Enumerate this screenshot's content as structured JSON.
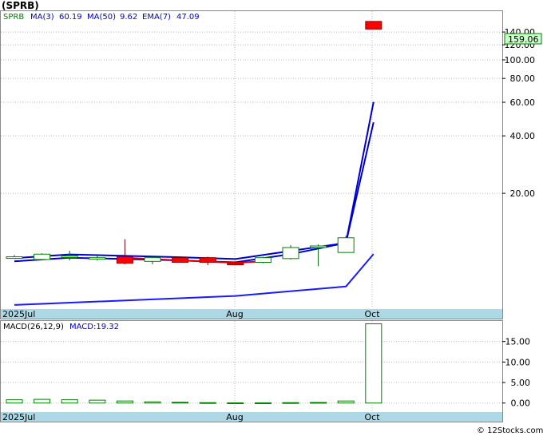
{
  "title": "(SPRB)",
  "footer": "© 12Stocks.com",
  "legend": {
    "symbol": "SPRB",
    "ma3_label": "MA(3)",
    "ma3_value": "60.19",
    "ma50_label": "MA(50)",
    "ma50_value": "9.62",
    "ema7_label": "EMA(7)",
    "ema7_value": "47.09"
  },
  "macd_legend": {
    "params": "MACD(26,12,9)",
    "label": "MACD:19.32"
  },
  "last_price_tag": "159.06",
  "colors": {
    "up": "#008000",
    "down": "#ff0000",
    "ma3": "#0000cc",
    "ma50": "#1a1aff",
    "ema7": "#dd0000",
    "axis_band": "#add8e6",
    "price_tag_bg": "#ccffcc"
  },
  "chart_data": [
    {
      "type": "candlestick",
      "yscale": "log",
      "ylim": [
        5,
        180
      ],
      "y_ticks": [
        "20.00",
        "40.00",
        "60.00",
        "80.00",
        "100.00",
        "120.00",
        "140.00"
      ],
      "x_labels": [
        "2025Jul",
        "Aug",
        "Oct"
      ],
      "last_price": 159.06,
      "candles": [
        {
          "i": 0,
          "open": 9.3,
          "close": 9.3,
          "high": 9.5,
          "low": 9.1
        },
        {
          "i": 1,
          "open": 9.0,
          "close": 9.6,
          "high": 9.7,
          "low": 9.0
        },
        {
          "i": 2,
          "open": 9.4,
          "close": 9.4,
          "high": 10.0,
          "low": 8.9
        },
        {
          "i": 3,
          "open": 9.2,
          "close": 9.2,
          "high": 9.5,
          "low": 8.9
        },
        {
          "i": 4,
          "open": 9.3,
          "close": 8.6,
          "high": 11.5,
          "low": 8.5
        },
        {
          "i": 5,
          "open": 8.8,
          "close": 9.2,
          "high": 9.3,
          "low": 8.5
        },
        {
          "i": 6,
          "open": 9.2,
          "close": 8.7,
          "high": 9.3,
          "low": 8.7
        },
        {
          "i": 7,
          "open": 9.2,
          "close": 8.7,
          "high": 9.3,
          "low": 8.4
        },
        {
          "i": 8,
          "open": 8.6,
          "close": 8.5,
          "high": 8.8,
          "low": 8.5
        },
        {
          "i": 9,
          "open": 8.7,
          "close": 9.2,
          "high": 9.3,
          "low": 8.6
        },
        {
          "i": 10,
          "open": 9.1,
          "close": 10.4,
          "high": 10.7,
          "low": 9.0
        },
        {
          "i": 11,
          "open": 10.6,
          "close": 10.6,
          "high": 10.8,
          "low": 8.3
        },
        {
          "i": 12,
          "open": 9.8,
          "close": 11.7,
          "high": 12.0,
          "low": 9.8
        },
        {
          "i": 13,
          "open": 159.06,
          "close": 145.0,
          "high": 159.06,
          "low": 145.0
        }
      ],
      "ma3": [
        [
          0,
          8.8
        ],
        [
          2,
          9.2
        ],
        [
          6,
          8.9
        ],
        [
          8,
          8.7
        ],
        [
          10,
          9.6
        ],
        [
          12,
          11.0
        ],
        [
          13,
          60.19
        ]
      ],
      "ma50": [
        [
          0,
          5.2
        ],
        [
          8,
          5.8
        ],
        [
          12,
          6.5
        ],
        [
          13,
          9.62
        ]
      ],
      "ema7": [
        [
          4,
          9.2
        ],
        [
          6,
          8.9
        ],
        [
          8,
          8.65
        ],
        [
          9,
          8.8
        ]
      ]
    },
    {
      "type": "bar",
      "name": "MACD",
      "ylim": [
        -2,
        20
      ],
      "y_ticks": [
        "0.00",
        "5.00",
        "10.00",
        "15.00"
      ],
      "x_labels": [
        "2025Jul",
        "Aug",
        "Oct"
      ],
      "bars": [
        {
          "i": 0,
          "value": 0.8
        },
        {
          "i": 1,
          "value": 0.9
        },
        {
          "i": 2,
          "value": 0.8
        },
        {
          "i": 3,
          "value": 0.7
        },
        {
          "i": 4,
          "value": 0.5
        },
        {
          "i": 5,
          "value": 0.3
        },
        {
          "i": 6,
          "value": 0.2
        },
        {
          "i": 7,
          "value": 0.1
        },
        {
          "i": 8,
          "value": 0.05
        },
        {
          "i": 9,
          "value": 0.05
        },
        {
          "i": 10,
          "value": 0.1
        },
        {
          "i": 11,
          "value": 0.15
        },
        {
          "i": 12,
          "value": 0.5
        },
        {
          "i": 13,
          "value": 19.32
        }
      ]
    }
  ]
}
